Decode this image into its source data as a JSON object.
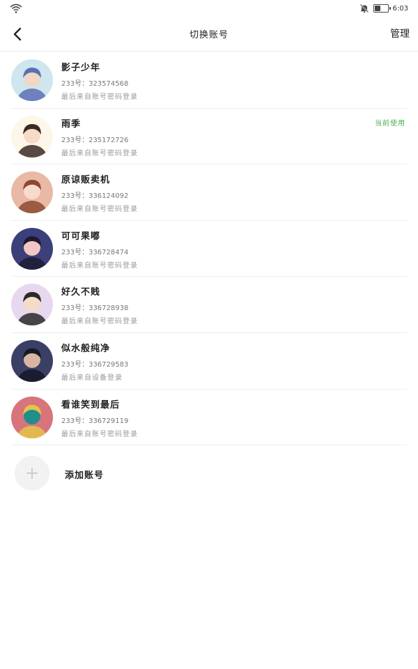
{
  "status_bar": {
    "time": "6:03",
    "battery_level": 0.45
  },
  "header": {
    "title": "切换账号",
    "manage_label": "管理"
  },
  "accounts": [
    {
      "name": "影子少年",
      "id_text": "233号：323574568",
      "login_text": "最后来自账号密码登录",
      "current": false,
      "avatar_colors": [
        "#cfe6ee",
        "#5b6fb4",
        "#f2d7c7"
      ]
    },
    {
      "name": "雨季",
      "id_text": "233号：235172726",
      "login_text": "最后来自账号密码登录",
      "current": true,
      "avatar_colors": [
        "#fdf7ea",
        "#3b2a24",
        "#f6dcc6"
      ]
    },
    {
      "name": "原谅贩卖机",
      "id_text": "233号：336124092",
      "login_text": "最后来自账号密码登录",
      "current": false,
      "avatar_colors": [
        "#e9b9a6",
        "#8b4a2f",
        "#f7dccd"
      ]
    },
    {
      "name": "可可果嘟",
      "id_text": "233号：336728474",
      "login_text": "最后来自账号密码登录",
      "current": false,
      "avatar_colors": [
        "#3b3f7a",
        "#1d1b33",
        "#f2c6c1"
      ]
    },
    {
      "name": "好久不贱",
      "id_text": "233号：336728938",
      "login_text": "最后来自账号密码登录",
      "current": false,
      "avatar_colors": [
        "#e8d8ef",
        "#2a2a2a",
        "#f5dcc8"
      ]
    },
    {
      "name": "似水般纯净",
      "id_text": "233号：336729583",
      "login_text": "最后来自设备登录",
      "current": false,
      "avatar_colors": [
        "#3a3f66",
        "#151828",
        "#d9b4a0"
      ]
    },
    {
      "name": "看谁笑到最后",
      "id_text": "233号：336729119",
      "login_text": "最后来自账号密码登录",
      "current": false,
      "avatar_colors": [
        "#d9747c",
        "#e3c54a",
        "#1f8f8a"
      ]
    }
  ],
  "current_label": "当前使用",
  "add_account": {
    "label": "添加账号"
  },
  "colors": {
    "accent_green": "#4caf50",
    "divider": "#efefef"
  }
}
